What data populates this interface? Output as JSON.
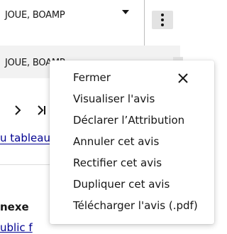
{
  "table": {
    "row1_value": "JOUE, BOAMP",
    "row2_value": "JOUE, BOAMP"
  },
  "pagination": {
    "next_icon": "chevron-right-icon",
    "last_icon": "last-page-icon"
  },
  "background": {
    "link_fragment": "u tableau (",
    "section_label": "nexe",
    "bottom_link_fragment": "ublic f"
  },
  "context_menu": {
    "close_icon": "close-icon",
    "items": [
      "Fermer",
      "Visualiser l'avis",
      "Déclarer l’Attribution",
      "Annuler cet avis",
      "Rectifier cet avis",
      "Dupliquer cet avis",
      "Télécharger l'avis (.pdf)"
    ]
  },
  "colors": {
    "link": "#000091",
    "row_alt_bg": "#f2f2f2",
    "button_bg": "#e3e3e3",
    "text": "#161616"
  }
}
